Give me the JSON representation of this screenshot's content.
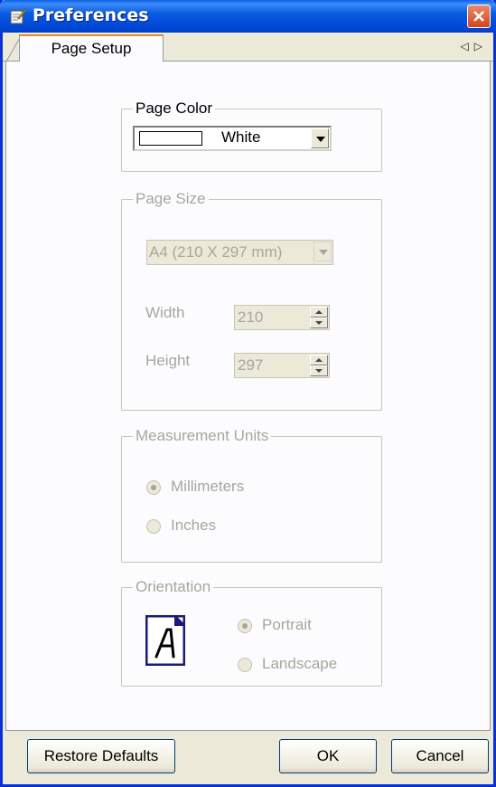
{
  "window": {
    "title": "Preferences"
  },
  "tabs": [
    {
      "label": "Page Setup",
      "active": true
    }
  ],
  "tab_scroll": {
    "left_icon": "triangle-left",
    "right_icon": "triangle-right"
  },
  "page_color": {
    "legend": "Page Color",
    "selected": "White",
    "swatch_color": "#ffffff"
  },
  "page_size": {
    "legend": "Page Size",
    "selected": "A4 (210 X 297 mm)",
    "width_label": "Width",
    "width_value": "210",
    "height_label": "Height",
    "height_value": "297",
    "enabled": false
  },
  "measurement_units": {
    "legend": "Measurement Units",
    "options": [
      {
        "label": "Millimeters",
        "checked": true
      },
      {
        "label": "Inches",
        "checked": false
      }
    ],
    "enabled": false
  },
  "orientation": {
    "legend": "Orientation",
    "options": [
      {
        "label": "Portrait",
        "checked": true
      },
      {
        "label": "Landscape",
        "checked": false
      }
    ],
    "enabled": false
  },
  "buttons": {
    "restore": "Restore Defaults",
    "ok": "OK",
    "cancel": "Cancel"
  },
  "colors": {
    "title_bar": "#0a5ddf",
    "accent_tab": "#e68b2c",
    "disabled_text": "#a7a69c",
    "orientation_icon": "#1a1a7a"
  }
}
